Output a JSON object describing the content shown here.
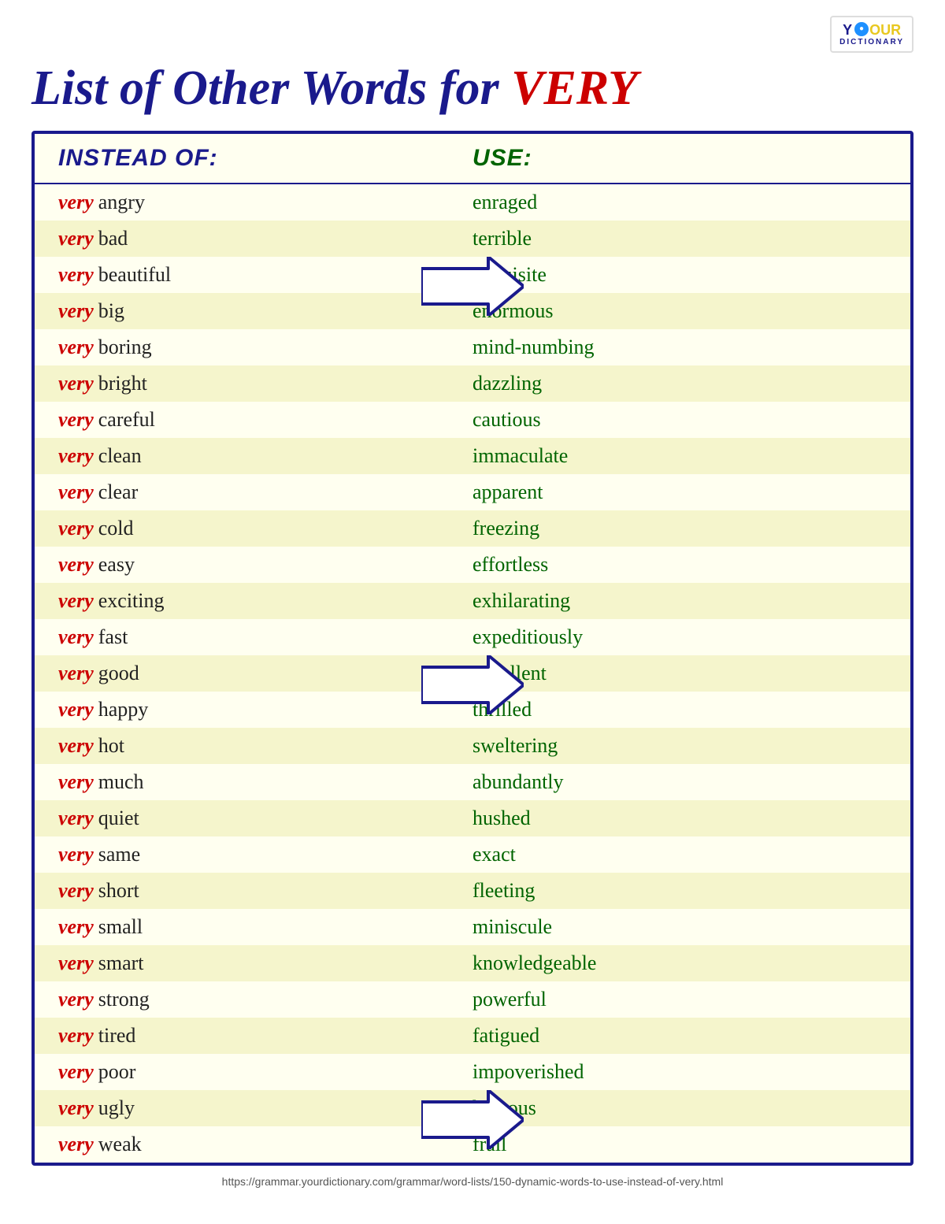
{
  "logo": {
    "y": "Y",
    "our": "OUR",
    "dictionary": "DICTIONARY"
  },
  "title": {
    "prefix": "List of Other Words for ",
    "very": "VERY"
  },
  "header": {
    "instead": "INSTEAD OF:",
    "use": "USE:"
  },
  "rows": [
    {
      "very": "very",
      "adj": "angry",
      "synonym": "enraged",
      "arrow": false
    },
    {
      "very": "very",
      "adj": "bad",
      "synonym": "terrible",
      "arrow": true,
      "arrowGroup": 1
    },
    {
      "very": "very",
      "adj": "beautiful",
      "synonym": "exquisite",
      "arrow": false
    },
    {
      "very": "very",
      "adj": "big",
      "synonym": "enormous",
      "arrow": false
    },
    {
      "very": "very",
      "adj": "boring",
      "synonym": "mind-numbing",
      "arrow": false
    },
    {
      "very": "very",
      "adj": "bright",
      "synonym": "dazzling",
      "arrow": false
    },
    {
      "very": "very",
      "adj": "careful",
      "synonym": "cautious",
      "arrow": false
    },
    {
      "very": "very",
      "adj": "clean",
      "synonym": "immaculate",
      "arrow": false
    },
    {
      "very": "very",
      "adj": "clear",
      "synonym": "apparent",
      "arrow": false
    },
    {
      "very": "very",
      "adj": "cold",
      "synonym": "freezing",
      "arrow": false
    },
    {
      "very": "very",
      "adj": "easy",
      "synonym": "effortless",
      "arrow": false
    },
    {
      "very": "very",
      "adj": "exciting",
      "synonym": "exhilarating",
      "arrow": false
    },
    {
      "very": "very",
      "adj": "fast",
      "synonym": "expeditiously",
      "arrow": true,
      "arrowGroup": 2
    },
    {
      "very": "very",
      "adj": "good",
      "synonym": "excellent",
      "arrow": false
    },
    {
      "very": "very",
      "adj": "happy",
      "synonym": "thrilled",
      "arrow": false
    },
    {
      "very": "very",
      "adj": "hot",
      "synonym": "sweltering",
      "arrow": false
    },
    {
      "very": "very",
      "adj": "much",
      "synonym": "abundantly",
      "arrow": false
    },
    {
      "very": "very",
      "adj": "quiet",
      "synonym": "hushed",
      "arrow": false
    },
    {
      "very": "very",
      "adj": "same",
      "synonym": "exact",
      "arrow": false
    },
    {
      "very": "very",
      "adj": "short",
      "synonym": "fleeting",
      "arrow": false
    },
    {
      "very": "very",
      "adj": "small",
      "synonym": "miniscule",
      "arrow": false
    },
    {
      "very": "very",
      "adj": "smart",
      "synonym": "knowledgeable",
      "arrow": false
    },
    {
      "very": "very",
      "adj": "strong",
      "synonym": "powerful",
      "arrow": false
    },
    {
      "very": "very",
      "adj": "tired",
      "synonym": "fatigued",
      "arrow": false
    },
    {
      "very": "very",
      "adj": "poor",
      "synonym": "impoverished",
      "arrow": true,
      "arrowGroup": 3
    },
    {
      "very": "very",
      "adj": "ugly",
      "synonym": "hideous",
      "arrow": false
    },
    {
      "very": "very",
      "adj": "weak",
      "synonym": "frail",
      "arrow": false
    }
  ],
  "footer": {
    "url": "https://grammar.yourdictionary.com/grammar/word-lists/150-dynamic-words-to-use-instead-of-very.html"
  }
}
